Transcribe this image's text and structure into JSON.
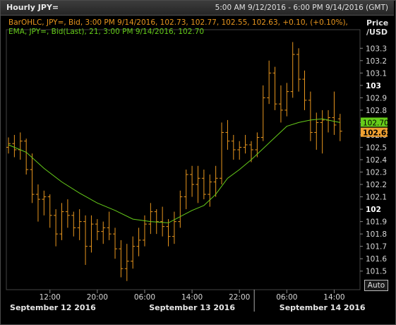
{
  "window": {
    "title": "Hourly JPY=",
    "range": "5:00 AM 9/12/2016 - 6:00 PM 9/14/2016 (GMT)"
  },
  "legend": {
    "ohlc": "BarOHLC, JPY=, Bid,  3:00 PM 9/14/2016, 102.73, 102.77, 102.55, 102.63, +0.10, (+0.10%),",
    "ema": "EMA, JPY=, Bid(Last),  21,  3:00 PM 9/14/2016, 102.70"
  },
  "axis": {
    "title_line1": "Price",
    "title_line2": "/USD",
    "auto_label": "Auto"
  },
  "colors": {
    "bars": "#e8961e",
    "ema": "#66cc1a",
    "ema_badge": "#66cc1a",
    "price_badge": "#f0a030",
    "background": "#000000",
    "text": "#cfcfcf"
  },
  "chart_data": {
    "type": "line",
    "title": "Hourly JPY=",
    "ylabel": "Price /USD",
    "ylim": [
      101.35,
      103.45
    ],
    "y_ticks": [
      101.5,
      101.6,
      101.7,
      101.8,
      101.9,
      102,
      102.1,
      102.2,
      102.3,
      102.4,
      102.5,
      102.6,
      102.7,
      102.8,
      102.9,
      103,
      103.1,
      103.2,
      103.3
    ],
    "y_tick_labels": [
      "101.5",
      "101.6",
      "101.7",
      "101.8",
      "101.9",
      "102",
      "102.1",
      "102.2",
      "102.3",
      "102.4",
      "102.5",
      "102.6",
      "102.7",
      "102.8",
      "102.9",
      "103",
      "103.1",
      "103.2",
      "103.3"
    ],
    "x_range": [
      0,
      59
    ],
    "x_ticks": [
      {
        "x": 7,
        "label": "12:00"
      },
      {
        "x": 15,
        "label": "20:00"
      },
      {
        "x": 23,
        "label": "06:00"
      },
      {
        "x": 31,
        "label": "14:00"
      },
      {
        "x": 39,
        "label": "22:00"
      },
      {
        "x": 47,
        "label": "06:00"
      },
      {
        "x": 55,
        "label": "14:00"
      }
    ],
    "date_labels": [
      {
        "x": 7.5,
        "label": "September 12 2016"
      },
      {
        "x": 31,
        "label": "September 13 2016"
      },
      {
        "x": 53,
        "label": "September 14 2016"
      }
    ],
    "day_separators": [
      41.5
    ],
    "series": [
      {
        "name": "BarOHLC",
        "type": "ohlc",
        "points": [
          [
            0,
            102.5,
            102.58,
            102.45,
            102.53
          ],
          [
            1,
            102.53,
            102.6,
            102.42,
            102.48
          ],
          [
            2,
            102.48,
            102.62,
            102.4,
            102.55
          ],
          [
            3,
            102.55,
            102.57,
            102.28,
            102.32
          ],
          [
            4,
            102.32,
            102.45,
            102.05,
            102.12
          ],
          [
            5,
            102.12,
            102.2,
            101.9,
            102.08
          ],
          [
            6,
            102.08,
            102.15,
            101.95,
            102.1
          ],
          [
            7,
            102.1,
            102.12,
            101.85,
            101.95
          ],
          [
            8,
            101.95,
            102.0,
            101.7,
            101.8
          ],
          [
            9,
            101.8,
            102.05,
            101.75,
            101.98
          ],
          [
            10,
            101.98,
            102.08,
            101.85,
            101.95
          ],
          [
            11,
            101.95,
            101.98,
            101.78,
            101.85
          ],
          [
            12,
            101.85,
            102.0,
            101.75,
            101.9
          ],
          [
            13,
            101.9,
            101.95,
            101.55,
            101.7
          ],
          [
            14,
            101.7,
            101.95,
            101.65,
            101.88
          ],
          [
            15,
            101.88,
            101.92,
            101.75,
            101.82
          ],
          [
            16,
            101.82,
            101.9,
            101.72,
            101.85
          ],
          [
            17,
            101.85,
            101.98,
            101.75,
            101.8
          ],
          [
            18,
            101.8,
            101.85,
            101.6,
            101.68
          ],
          [
            19,
            101.68,
            101.75,
            101.45,
            101.52
          ],
          [
            20,
            101.52,
            101.72,
            101.42,
            101.58
          ],
          [
            21,
            101.58,
            101.78,
            101.52,
            101.7
          ],
          [
            22,
            101.7,
            101.85,
            101.62,
            101.75
          ],
          [
            23,
            101.75,
            101.95,
            101.7,
            101.88
          ],
          [
            24,
            101.88,
            102.05,
            101.8,
            101.98
          ],
          [
            25,
            101.98,
            102.0,
            101.8,
            101.9
          ],
          [
            26,
            101.9,
            102.02,
            101.78,
            101.86
          ],
          [
            27,
            101.86,
            101.92,
            101.7,
            101.78
          ],
          [
            28,
            101.78,
            101.98,
            101.72,
            101.9
          ],
          [
            29,
            101.9,
            102.15,
            101.85,
            102.1
          ],
          [
            30,
            102.1,
            102.32,
            102.0,
            102.28
          ],
          [
            31,
            102.28,
            102.35,
            102.1,
            102.2
          ],
          [
            32,
            102.2,
            102.35,
            102.05,
            102.25
          ],
          [
            33,
            102.25,
            102.32,
            102.08,
            102.12
          ],
          [
            34,
            102.12,
            102.28,
            102.02,
            102.22
          ],
          [
            35,
            102.22,
            102.35,
            102.1,
            102.25
          ],
          [
            36,
            102.25,
            102.7,
            102.2,
            102.62
          ],
          [
            37,
            102.62,
            102.72,
            102.48,
            102.55
          ],
          [
            38,
            102.55,
            102.6,
            102.4,
            102.48
          ],
          [
            39,
            102.48,
            102.55,
            102.4,
            102.5
          ],
          [
            40,
            102.5,
            102.6,
            102.45,
            102.52
          ],
          [
            41,
            102.52,
            102.55,
            102.38,
            102.48
          ],
          [
            42,
            102.48,
            102.62,
            102.42,
            102.58
          ],
          [
            43,
            102.58,
            103.0,
            102.55,
            102.9
          ],
          [
            44,
            102.9,
            103.2,
            102.85,
            103.1
          ],
          [
            45,
            103.1,
            103.15,
            102.8,
            102.85
          ],
          [
            46,
            102.85,
            103.0,
            102.7,
            102.8
          ],
          [
            47,
            102.8,
            103.02,
            102.75,
            102.95
          ],
          [
            48,
            102.95,
            103.35,
            102.9,
            103.25
          ],
          [
            49,
            103.25,
            103.3,
            102.95,
            103.05
          ],
          [
            50,
            103.05,
            103.12,
            102.8,
            102.88
          ],
          [
            51,
            102.88,
            102.95,
            102.55,
            102.62
          ],
          [
            52,
            102.62,
            102.78,
            102.48,
            102.7
          ],
          [
            53,
            102.7,
            102.8,
            102.45,
            102.72
          ],
          [
            54,
            102.72,
            102.8,
            102.62,
            102.74
          ],
          [
            55,
            102.74,
            102.95,
            102.6,
            102.68
          ],
          [
            56,
            102.73,
            102.77,
            102.55,
            102.63
          ]
        ]
      },
      {
        "name": "EMA",
        "type": "line",
        "x": [
          0,
          3,
          6,
          9,
          12,
          15,
          18,
          21,
          24,
          27,
          29,
          31,
          33,
          35,
          37,
          39,
          41,
          43,
          45,
          47,
          49,
          51,
          53,
          55,
          56
        ],
        "values": [
          102.52,
          102.46,
          102.33,
          102.22,
          102.13,
          102.05,
          101.99,
          101.92,
          101.9,
          101.89,
          101.94,
          101.99,
          102.03,
          102.12,
          102.25,
          102.32,
          102.4,
          102.49,
          102.58,
          102.67,
          102.7,
          102.72,
          102.73,
          102.71,
          102.7
        ]
      }
    ],
    "last_values": {
      "ema": "102.70",
      "price": "102.63"
    }
  }
}
